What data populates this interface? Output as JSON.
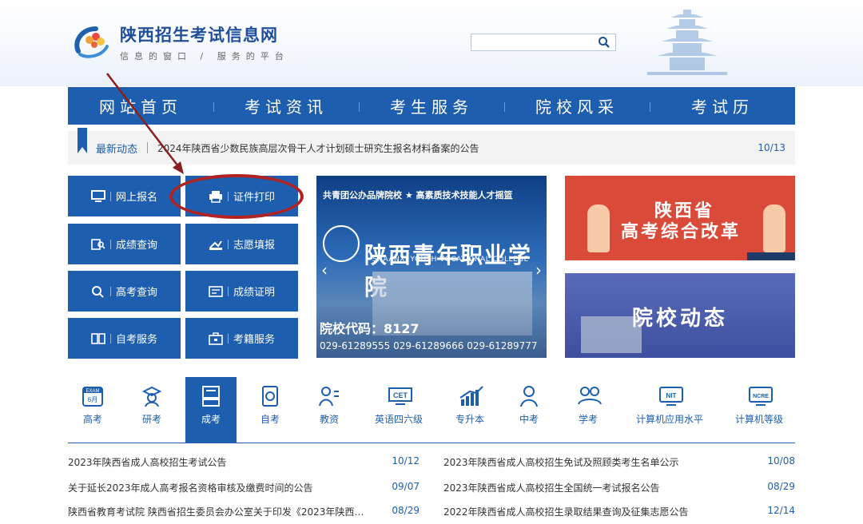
{
  "site": {
    "title": "陕西招生考试信息网",
    "subtitle": "信息的窗口 / 服务的平台"
  },
  "search": {
    "placeholder": "",
    "value": ""
  },
  "nav": {
    "items": [
      {
        "label": "网站首页"
      },
      {
        "label": "考试资讯"
      },
      {
        "label": "考生服务"
      },
      {
        "label": "院校风采"
      },
      {
        "label": "考试历"
      }
    ]
  },
  "ticker": {
    "label": "最新动态",
    "text": "2024年陕西省少数民族高层次骨干人才计划硕士研究生报名材料备案的公告",
    "date": "10/13"
  },
  "services": [
    {
      "label": "网上报名",
      "icon": "monitor-icon"
    },
    {
      "label": "证件打印",
      "icon": "printer-icon"
    },
    {
      "label": "成绩查询",
      "icon": "score-search-icon"
    },
    {
      "label": "志愿填报",
      "icon": "hand-write-icon"
    },
    {
      "label": "高考查询",
      "icon": "search-icon"
    },
    {
      "label": "成绩证明",
      "icon": "certificate-icon"
    },
    {
      "label": "自考服务",
      "icon": "book-icon"
    },
    {
      "label": "考籍服务",
      "icon": "briefcase-icon"
    }
  ],
  "banner": {
    "top": "共青团公办品牌院校 ★ 高素质技术技能人才摇篮",
    "name": "陕西青年职业学院",
    "en": "SHAANXI YOUTH VOCATIONAL COLLEGE",
    "code": "院校代码：8127",
    "tel": "029-61289555  029-61289666  029-61289777"
  },
  "right_banners": {
    "reform_line1": "陕西省",
    "reform_line2": "高考综合改革",
    "dynamics": "院校动态"
  },
  "tabs": [
    {
      "label": "高考",
      "icon": "exam-calendar-icon",
      "badge": "EXAM",
      "badge2": "6月"
    },
    {
      "label": "研考",
      "icon": "graduate-icon"
    },
    {
      "label": "成考",
      "icon": "adult-exam-icon",
      "active": true
    },
    {
      "label": "自考",
      "icon": "self-study-icon"
    },
    {
      "label": "教资",
      "icon": "teacher-icon"
    },
    {
      "label": "英语四六级",
      "icon": "cet-icon",
      "badge": "CET"
    },
    {
      "label": "专升本",
      "icon": "chart-up-icon"
    },
    {
      "label": "中考",
      "icon": "person-icon"
    },
    {
      "label": "学考",
      "icon": "group-icon"
    },
    {
      "label": "计算机应用水平",
      "icon": "nit-icon",
      "badge": "NIT"
    },
    {
      "label": "计算机等级",
      "icon": "ncre-icon",
      "badge": "NCRE"
    }
  ],
  "news_left": [
    {
      "title": "2023年陕西省成人高校招生考试公告",
      "date": "10/12"
    },
    {
      "title": "关于延长2023年成人高考报名资格审核及缴费时间的公告",
      "date": "09/07"
    },
    {
      "title": "陕西省教育考试院 陕西省招生委员会办公室关于印发《2023年陕西省...",
      "date": "08/29"
    }
  ],
  "news_right": [
    {
      "title": "2023年陕西省成人高校招生免试及照顾类考生名单公示",
      "date": "10/08"
    },
    {
      "title": "2023年陕西省成人高校招生全国统一考试报名公告",
      "date": "08/29"
    },
    {
      "title": "2022年陕西省成人高校招生录取结果查询及征集志愿公告",
      "date": "12/14"
    }
  ],
  "colors": {
    "brand": "#1d5fae",
    "highlight": "#b22222",
    "reform": "#d94b38"
  }
}
